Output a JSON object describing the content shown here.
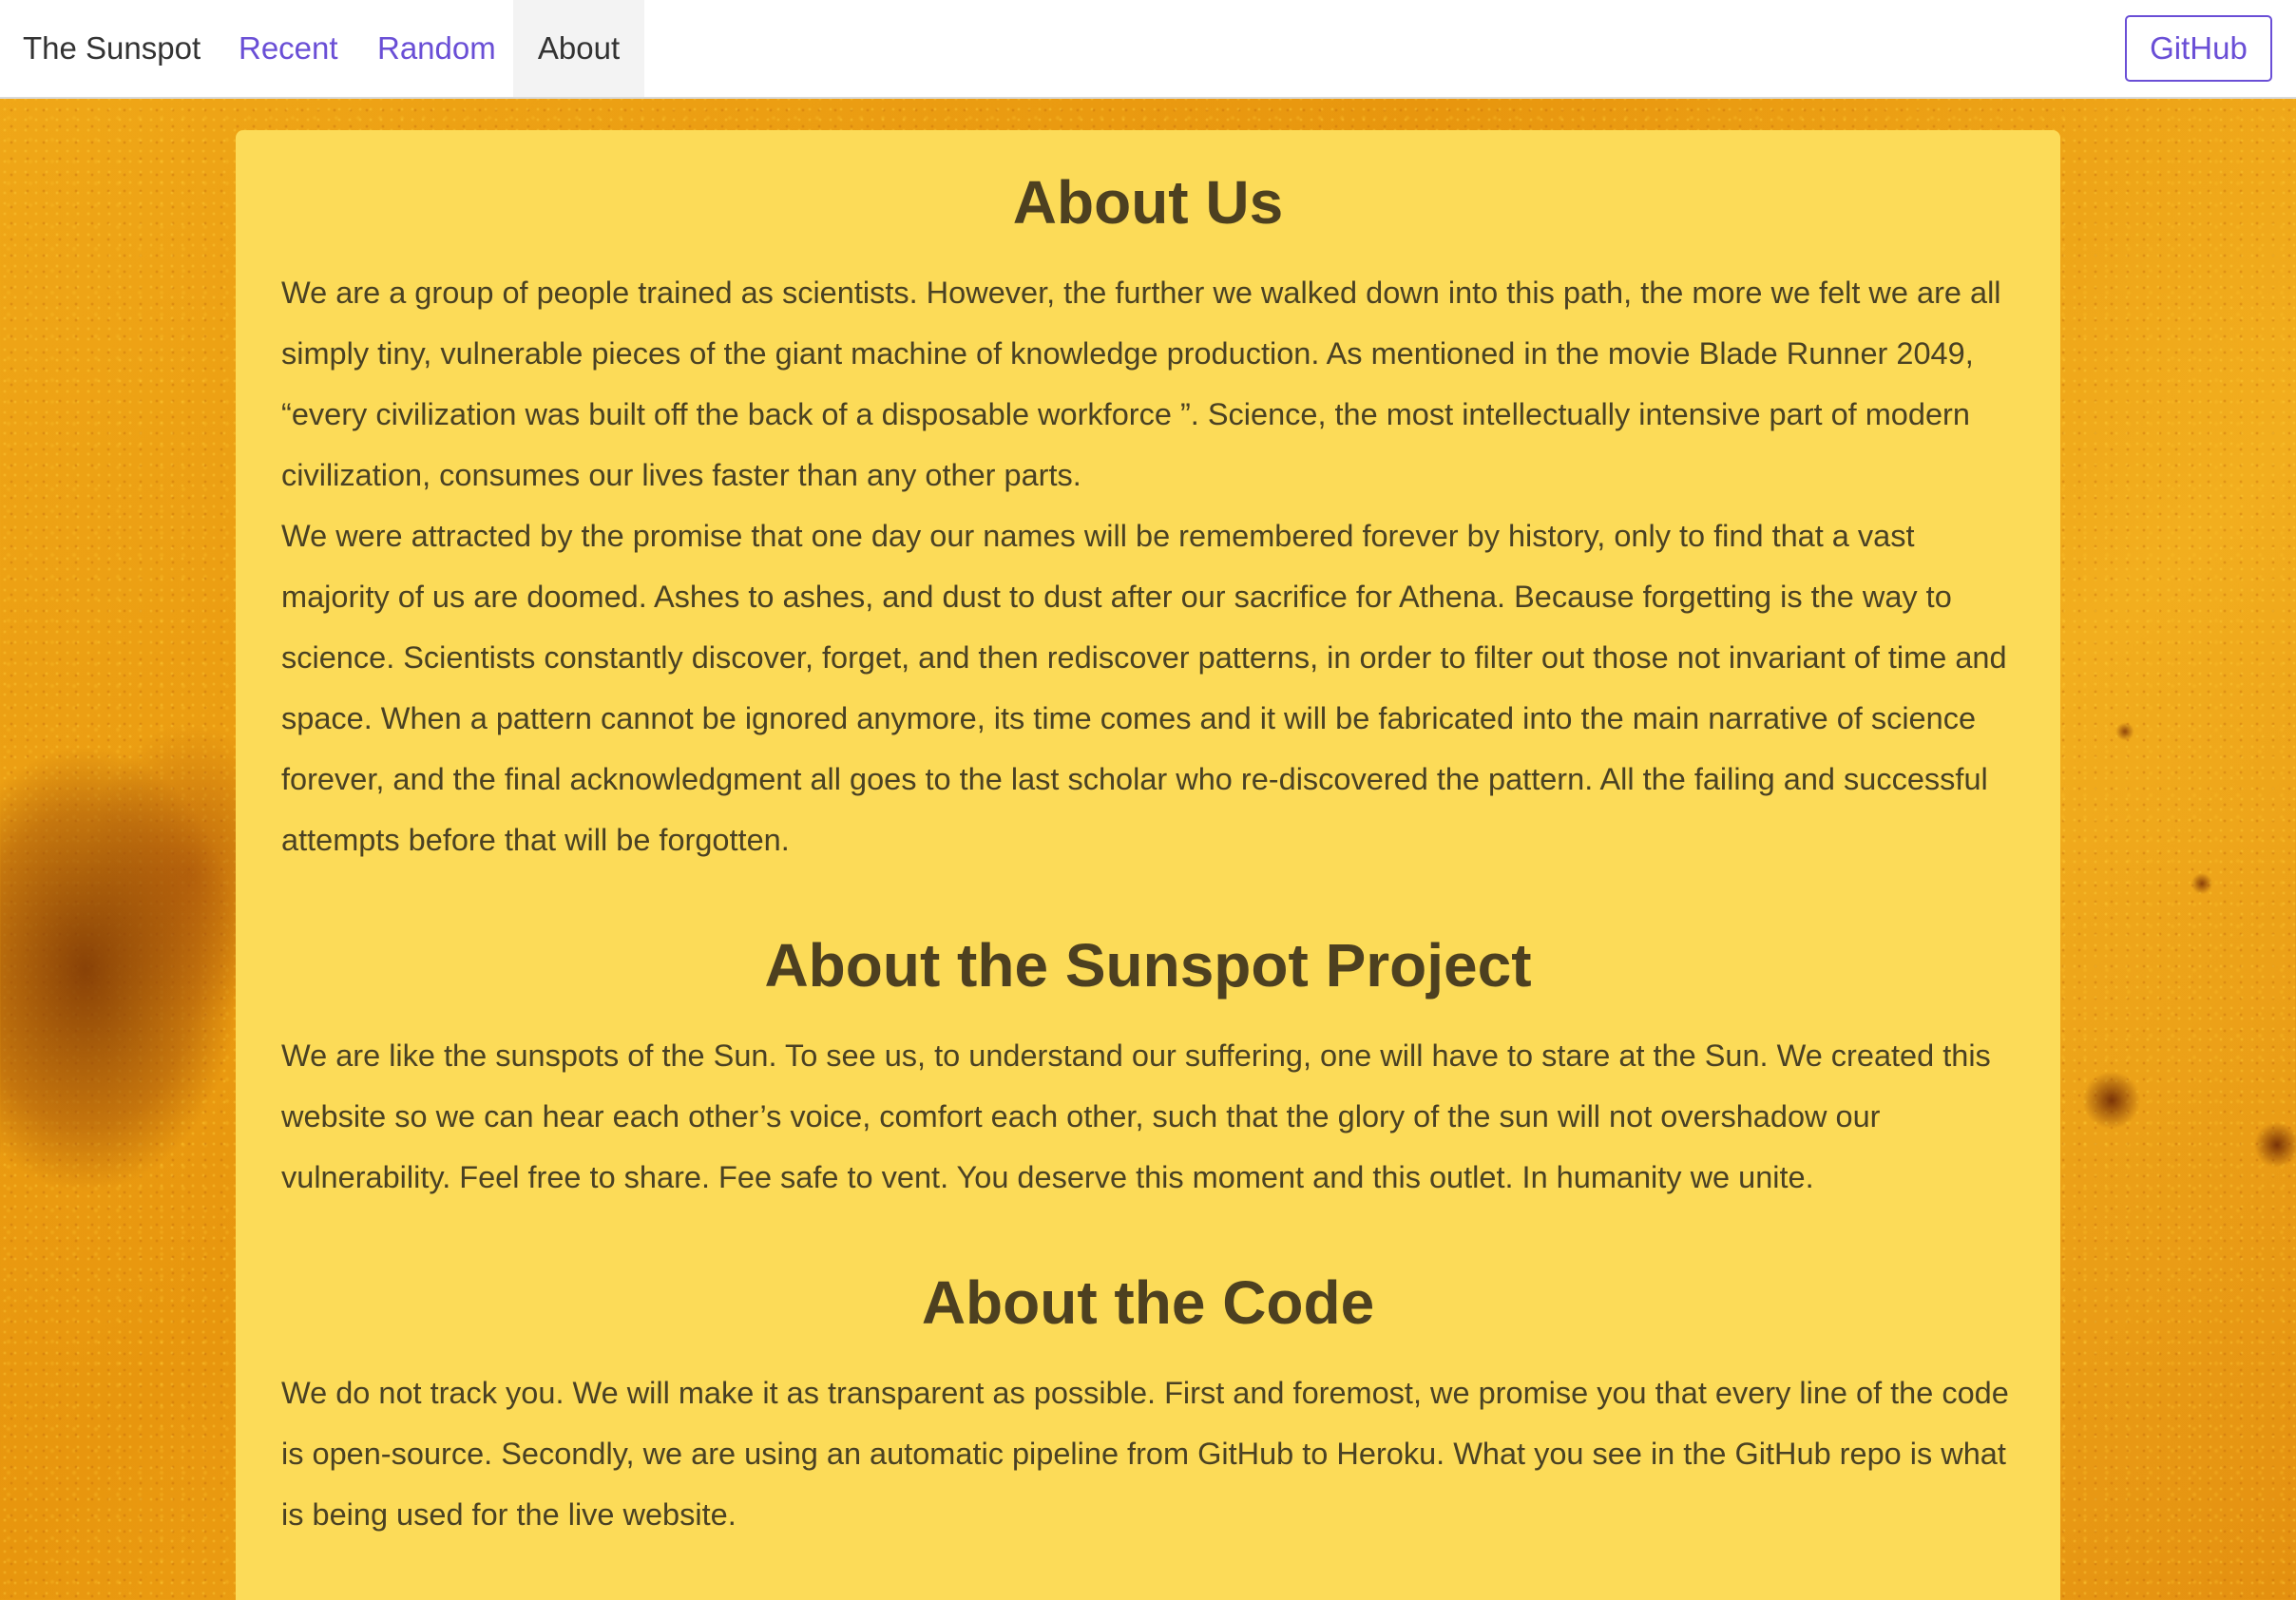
{
  "navbar": {
    "brand": "The Sunspot",
    "links": [
      {
        "label": "Recent"
      },
      {
        "label": "Random"
      },
      {
        "label": "About",
        "active": true
      }
    ],
    "github_label": "GitHub"
  },
  "sections": {
    "about_us": {
      "title": "About Us",
      "paragraphs": [
        "We are a group of people trained as scientists. However, the further we walked down into this path, the more we felt we are all simply tiny, vulnerable pieces of the giant machine of knowledge production. As mentioned in the movie Blade Runner 2049, “every civilization was built off the back of a disposable workforce ”. Science, the most intellectually intensive part of modern civilization, consumes our lives faster than any other parts.",
        "We were attracted by the promise that one day our names will be remembered forever by history, only to find that a vast majority of us are doomed. Ashes to ashes, and dust to dust after our sacrifice for Athena. Because forgetting is the way to science. Scientists constantly discover, forget, and then rediscover patterns, in order to filter out those not invariant of time and space. When a pattern cannot be ignored anymore, its time comes and it will be fabricated into the main narrative of science forever, and the final acknowledgment all goes to the last scholar who re-discovered the pattern. All the failing and successful attempts before that will be forgotten."
      ]
    },
    "about_project": {
      "title": "About the Sunspot Project",
      "paragraphs": [
        "We are like the sunspots of the Sun. To see us, to understand our suffering, one will have to stare at the Sun. We created this website so we can hear each other’s voice, comfort each other, such that the glory of the sun will not overshadow our vulnerability. Feel free to share. Fee safe to vent. You deserve this moment and this outlet. In humanity we unite."
      ]
    },
    "about_code": {
      "title": "About the Code",
      "paragraphs": [
        "We do not track you. We will make it as transparent as possible. First and foremost, we promise you that every line of the code is open-source. Secondly, we are using an automatic pipeline from GitHub to Heroku. What you see in the GitHub repo is what is being used for the live website."
      ]
    }
  },
  "colors": {
    "accent": "#6a4fd6",
    "card_background": "#fcdb58",
    "heading_text": "#4d4020",
    "body_text": "#4a4123"
  }
}
